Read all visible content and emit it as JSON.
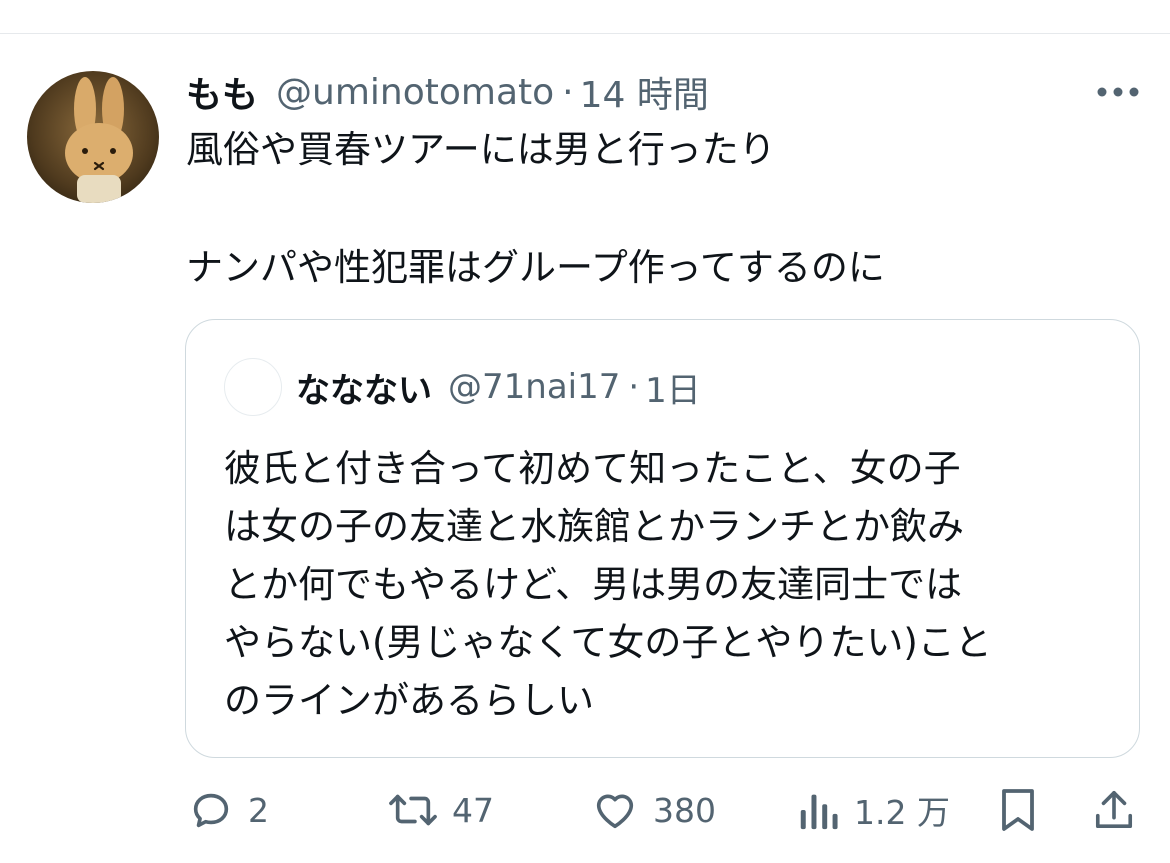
{
  "author": {
    "display_name": "もも",
    "handle": "@uminotomato",
    "separator": "·",
    "time": "14 時間"
  },
  "tweet": {
    "lines": [
      "風俗や買春ツアーには男と行ったり",
      "ナンパや性犯罪はグループ作ってするのに"
    ]
  },
  "quote": {
    "display_name": "ななない",
    "handle": "@71nai17",
    "separator": "·",
    "time": "1日",
    "lines": [
      "彼氏と付き合って初めて知ったこと、女の子",
      "は女の子の友達と水族館とかランチとか飲み",
      "とか何でもやるけど、男は男の友達同士では",
      "やらない(男じゃなくて女の子とやりたい)こと",
      "のラインがあるらしい"
    ]
  },
  "actions": {
    "replies": "2",
    "reposts": "47",
    "likes": "380",
    "views": "1.2 万"
  },
  "icons": {
    "more": "more-horizontal-icon",
    "reply": "reply-bubble-icon",
    "repost": "repost-arrows-icon",
    "like": "heart-icon",
    "views": "bar-chart-icon",
    "bookmark": "bookmark-icon",
    "share": "share-upload-icon"
  },
  "colors": {
    "text": "#0f1419",
    "secondary": "#536471",
    "border": "#cfd9de"
  }
}
